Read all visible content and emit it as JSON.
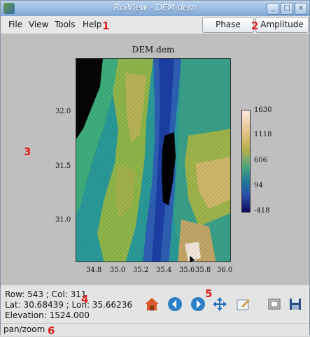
{
  "window": {
    "title": "RoiView - DEM dem"
  },
  "menu": [
    "File",
    "View",
    "Tools",
    "Help"
  ],
  "view_buttons": {
    "phase": "Phase",
    "amplitude": "Amplitude"
  },
  "annotations": [
    "1",
    "2",
    "3",
    "4",
    "5",
    "6"
  ],
  "figure": {
    "title": "DEM.dem",
    "y_ticks": [
      "32.0",
      "31.5",
      "31.0"
    ],
    "x_ticks": [
      "34.8",
      "35.0",
      "35.2",
      "35.4",
      "35.6",
      "35.8",
      "36.0"
    ],
    "colorbar_ticks": [
      "1630",
      "1118",
      "606",
      "94",
      "-418"
    ]
  },
  "status": {
    "row_col": "Row: 543 ; Col: 311",
    "lat_lon": "Lat: 30.68439 ; Lon: 35.66236",
    "elevation": "Elevation: 1524.000"
  },
  "toolbar": [
    "home-icon",
    "back-icon",
    "forward-icon",
    "pan-icon",
    "zoom-icon",
    "configure-icon",
    "save-icon"
  ],
  "statusbar": {
    "mode": "pan/zoom"
  },
  "colors": {
    "annotation": "#e02020",
    "titlebar": "#7ea6d4"
  }
}
